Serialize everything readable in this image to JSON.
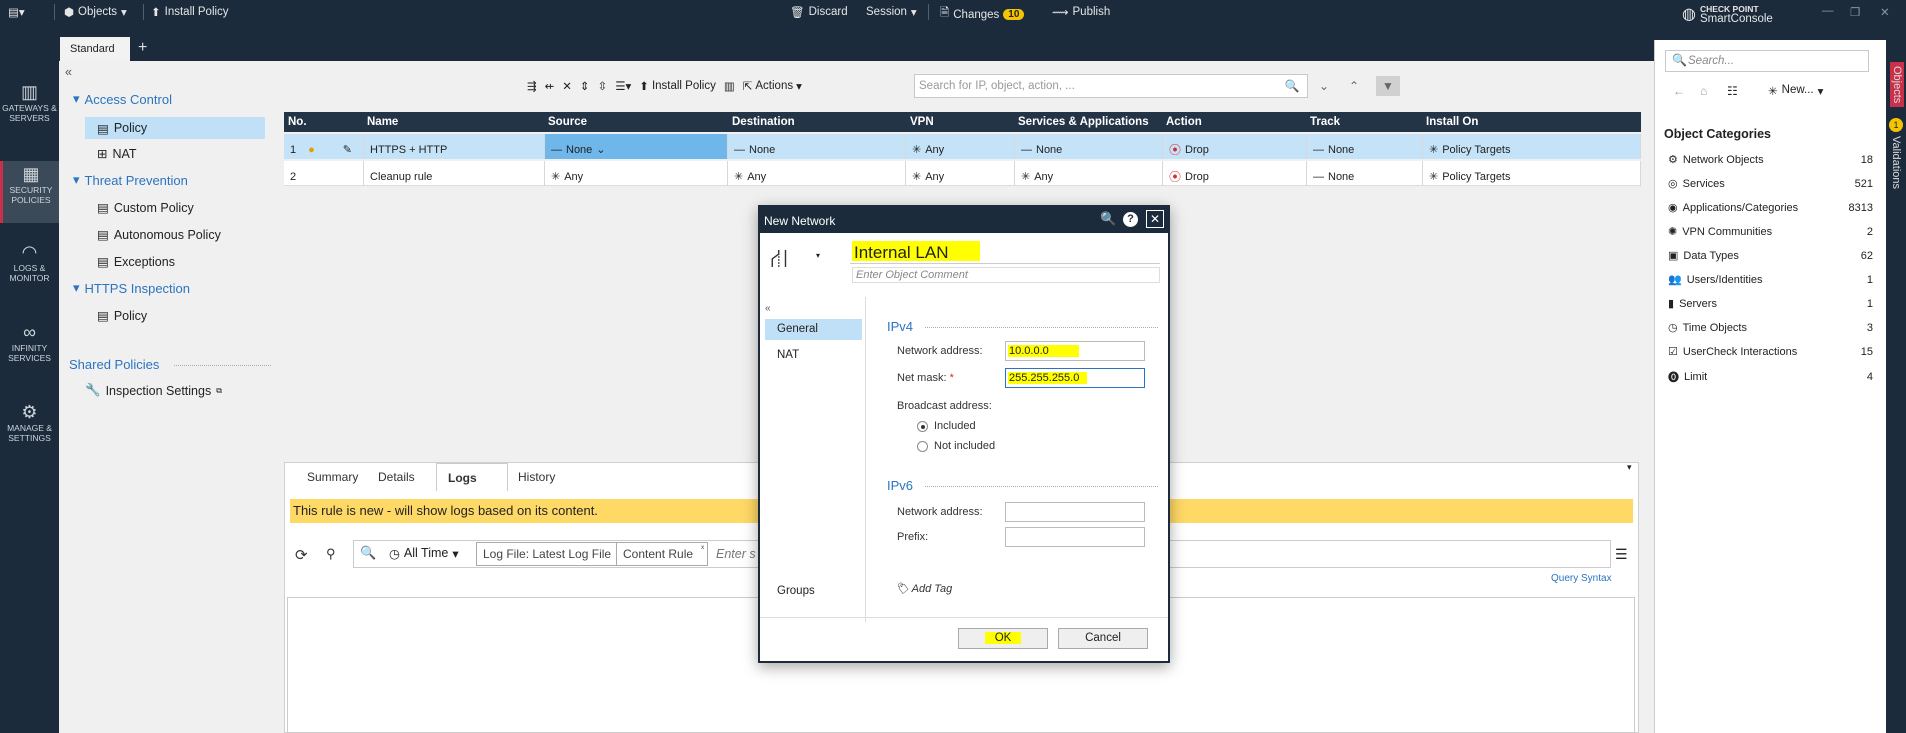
{
  "topbar": {
    "objects_label": "Objects",
    "install_label": "Install Policy",
    "discard_label": "Discard",
    "session_label": "Session",
    "changes_label": "Changes",
    "changes_count": "10",
    "publish_label": "Publish",
    "brand_line1": "CHECK POINT",
    "brand_line2": "SmartConsole"
  },
  "tabs": {
    "standard": "Standard",
    "add": "+"
  },
  "leftnav": {
    "gateways": "GATEWAYS & SERVERS",
    "security": "SECURITY POLICIES",
    "logs": "LOGS & MONITOR",
    "infinity": "INFINITY SERVICES",
    "manage": "MANAGE & SETTINGS"
  },
  "tree": {
    "access_control": "Access Control",
    "policy": "Policy",
    "nat": "NAT",
    "threat_prevention": "Threat Prevention",
    "custom_policy": "Custom Policy",
    "autonomous_policy": "Autonomous Policy",
    "exceptions": "Exceptions",
    "https_inspection": "HTTPS Inspection",
    "https_policy": "Policy",
    "shared_policies": "Shared Policies",
    "inspection_settings": "Inspection Settings"
  },
  "toolbar": {
    "install_policy": "Install Policy",
    "actions": "Actions",
    "search_placeholder": "Search for IP, object, action, ..."
  },
  "grid": {
    "headers": [
      "No.",
      "Name",
      "Source",
      "Destination",
      "VPN",
      "Services & Applications",
      "Action",
      "Track",
      "Install On"
    ],
    "rows": [
      {
        "no": "1",
        "name": "HTTPS + HTTP",
        "source": "None",
        "destination": "None",
        "vpn": "Any",
        "services": "None",
        "action": "Drop",
        "track": "None",
        "install_on": "Policy Targets"
      },
      {
        "no": "2",
        "name": "Cleanup rule",
        "source": "Any",
        "destination": "Any",
        "vpn": "Any",
        "services": "Any",
        "action": "Drop",
        "track": "None",
        "install_on": "Policy Targets"
      }
    ]
  },
  "bottom": {
    "tabs": [
      "Summary",
      "Details",
      "Logs",
      "History"
    ],
    "banner": "This rule is new - will show logs based on its content.",
    "time": "All Time",
    "log_file": "Log File: Latest Log File",
    "content_rule": "Content Rule",
    "query_placeholder": "Enter s",
    "query_syntax": "Query Syntax"
  },
  "right": {
    "search_placeholder": "Search...",
    "new_label": "New...",
    "categories_title": "Object Categories",
    "categories": [
      {
        "name": "Network Objects",
        "count": "18",
        "icon": "network-icon"
      },
      {
        "name": "Services",
        "count": "521",
        "icon": "services-icon"
      },
      {
        "name": "Applications/Categories",
        "count": "8313",
        "icon": "apps-icon"
      },
      {
        "name": "VPN Communities",
        "count": "2",
        "icon": "vpn-icon"
      },
      {
        "name": "Data Types",
        "count": "62",
        "icon": "data-icon"
      },
      {
        "name": "Users/Identities",
        "count": "1",
        "icon": "users-icon"
      },
      {
        "name": "Servers",
        "count": "1",
        "icon": "server-icon"
      },
      {
        "name": "Time Objects",
        "count": "3",
        "icon": "clock-icon"
      },
      {
        "name": "UserCheck Interactions",
        "count": "15",
        "icon": "usercheck-icon"
      },
      {
        "name": "Limit",
        "count": "4",
        "icon": "limit-icon"
      }
    ],
    "strip_objects": "Objects",
    "strip_validations": "Validations",
    "validations_count": "1"
  },
  "dialog": {
    "title": "New Network",
    "name": "Internal LAN",
    "comment_placeholder": "Enter Object Comment",
    "nav": [
      "General",
      "NAT",
      "Groups"
    ],
    "ipv4_title": "IPv4",
    "network_address_label": "Network address:",
    "network_address": "10.0.0.0",
    "netmask_label": "Net mask:",
    "netmask": "255.255.255.0",
    "broadcast_label": "Broadcast address:",
    "included": "Included",
    "not_included": "Not included",
    "ipv6_title": "IPv6",
    "ipv6_address_label": "Network address:",
    "prefix_label": "Prefix:",
    "add_tag": "Add Tag",
    "ok": "OK",
    "cancel": "Cancel"
  },
  "colors": {
    "navy": "#1c2b3c",
    "highlight": "#ffff00",
    "selection": "#c4e3f8",
    "banner": "#ffd966",
    "drop": "#d32f2f",
    "link": "#2b74c2"
  }
}
